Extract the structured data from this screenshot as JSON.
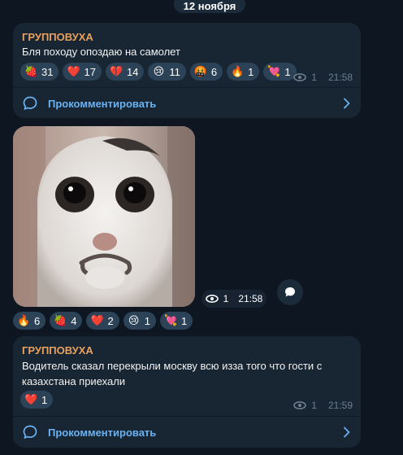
{
  "date_separator": "12 ноября",
  "post1": {
    "sender": "ГРУППОВУХА",
    "text": "Бля походу опоздаю на самолет",
    "reactions": [
      {
        "emoji": "🍓",
        "count": "31"
      },
      {
        "emoji": "❤️",
        "count": "17"
      },
      {
        "emoji": "💔",
        "count": "14"
      },
      {
        "emoji": "😢",
        "count": "11"
      },
      {
        "emoji": "🤬",
        "count": "6"
      },
      {
        "emoji": "🔥",
        "count": "1"
      },
      {
        "emoji": "💘",
        "count": "1"
      }
    ],
    "views": "1",
    "time": "21:58",
    "comment_label": "Прокомментировать"
  },
  "post2": {
    "views": "1",
    "time": "21:58",
    "reactions": [
      {
        "emoji": "🔥",
        "count": "6"
      },
      {
        "emoji": "🍓",
        "count": "4"
      },
      {
        "emoji": "❤️",
        "count": "2"
      },
      {
        "emoji": "😢",
        "count": "1"
      },
      {
        "emoji": "💘",
        "count": "1"
      }
    ]
  },
  "post3": {
    "sender": "ГРУППОВУХА",
    "text": "Водитель сказал перекрыли москву всю изза того что гости с казахстана приехали",
    "reactions": [
      {
        "emoji": "❤️",
        "count": "1"
      }
    ],
    "views": "1",
    "time": "21:59",
    "comment_label": "Прокомментировать"
  },
  "icons": {
    "views": "eye-icon",
    "comment": "comment-bubble-icon",
    "chevron": "chevron-right-icon",
    "reply": "reply-bubble-icon"
  },
  "colors": {
    "background": "#0e1621",
    "bubble": "#182533",
    "sender": "#e8a25e",
    "link": "#6ab2f2",
    "reaction_bg": "#2b4257"
  }
}
